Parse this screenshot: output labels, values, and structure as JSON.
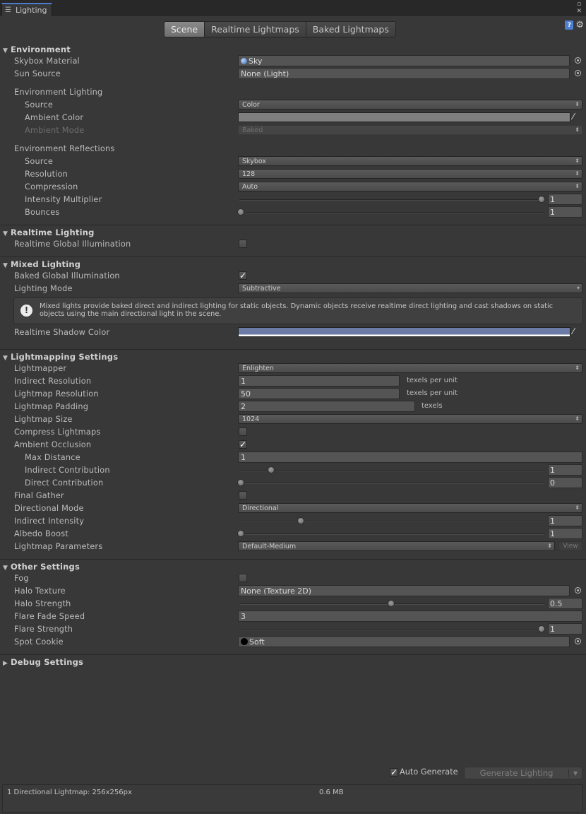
{
  "window": {
    "tab_title": "Lighting",
    "tab_icon": "lighting-icon"
  },
  "toolbar": {
    "tabs": [
      "Scene",
      "Realtime Lightmaps",
      "Baked Lightmaps"
    ],
    "active": "Scene"
  },
  "environment": {
    "header": "Environment",
    "skybox_material": {
      "label": "Skybox Material",
      "value": "Sky"
    },
    "sun_source": {
      "label": "Sun Source",
      "value": "None (Light)"
    },
    "env_lighting": {
      "label": "Environment Lighting"
    },
    "source": {
      "label": "Source",
      "value": "Color"
    },
    "ambient_color": {
      "label": "Ambient Color",
      "color": "#7f7f7f"
    },
    "ambient_mode": {
      "label": "Ambient Mode",
      "value": "Baked"
    },
    "env_reflections": {
      "label": "Environment Reflections"
    },
    "refl_source": {
      "label": "Source",
      "value": "Skybox"
    },
    "resolution": {
      "label": "Resolution",
      "value": "128"
    },
    "compression": {
      "label": "Compression",
      "value": "Auto"
    },
    "intensity_multiplier": {
      "label": "Intensity Multiplier",
      "value": "1"
    },
    "bounces": {
      "label": "Bounces",
      "value": "1"
    }
  },
  "realtime": {
    "header": "Realtime Lighting",
    "realtime_gi": {
      "label": "Realtime Global Illumination",
      "checked": false
    }
  },
  "mixed": {
    "header": "Mixed Lighting",
    "baked_gi": {
      "label": "Baked Global Illumination",
      "checked": true
    },
    "lighting_mode": {
      "label": "Lighting Mode",
      "value": "Subtractive"
    },
    "help": "Mixed lights provide baked direct and indirect lighting for static objects. Dynamic objects receive realtime direct lighting and cast shadows on static objects using the main directional light in the scene.",
    "shadow_color": {
      "label": "Realtime Shadow Color",
      "color": "#6b7ba5"
    }
  },
  "lightmapping": {
    "header": "Lightmapping Settings",
    "lightmapper": {
      "label": "Lightmapper",
      "value": "Enlighten"
    },
    "indirect_resolution": {
      "label": "Indirect Resolution",
      "value": "1",
      "suffix": "texels per unit"
    },
    "lightmap_resolution": {
      "label": "Lightmap Resolution",
      "value": "50",
      "suffix": "texels per unit"
    },
    "lightmap_padding": {
      "label": "Lightmap Padding",
      "value": "2",
      "suffix": "texels"
    },
    "lightmap_size": {
      "label": "Lightmap Size",
      "value": "1024"
    },
    "compress": {
      "label": "Compress Lightmaps",
      "checked": false
    },
    "ambient_occlusion": {
      "label": "Ambient Occlusion",
      "checked": true
    },
    "max_distance": {
      "label": "Max Distance",
      "value": "1"
    },
    "indirect_contribution": {
      "label": "Indirect Contribution",
      "value": "1"
    },
    "direct_contribution": {
      "label": "Direct Contribution",
      "value": "0"
    },
    "final_gather": {
      "label": "Final Gather",
      "checked": false
    },
    "directional_mode": {
      "label": "Directional Mode",
      "value": "Directional"
    },
    "indirect_intensity": {
      "label": "Indirect Intensity",
      "value": "1"
    },
    "albedo_boost": {
      "label": "Albedo Boost",
      "value": "1"
    },
    "lightmap_parameters": {
      "label": "Lightmap Parameters",
      "value": "Default-Medium",
      "view": "View"
    }
  },
  "other": {
    "header": "Other Settings",
    "fog": {
      "label": "Fog",
      "checked": false
    },
    "halo_texture": {
      "label": "Halo Texture",
      "value": "None (Texture 2D)"
    },
    "halo_strength": {
      "label": "Halo Strength",
      "value": "0.5"
    },
    "flare_fade_speed": {
      "label": "Flare Fade Speed",
      "value": "3"
    },
    "flare_strength": {
      "label": "Flare Strength",
      "value": "1"
    },
    "spot_cookie": {
      "label": "Spot Cookie",
      "value": "Soft"
    }
  },
  "debug": {
    "header": "Debug Settings"
  },
  "footer": {
    "auto_generate": {
      "label": "Auto Generate",
      "checked": true
    },
    "generate_button": "Generate Lighting",
    "status_left": "1 Directional Lightmap: 256x256px",
    "status_right": "0.6 MB"
  }
}
